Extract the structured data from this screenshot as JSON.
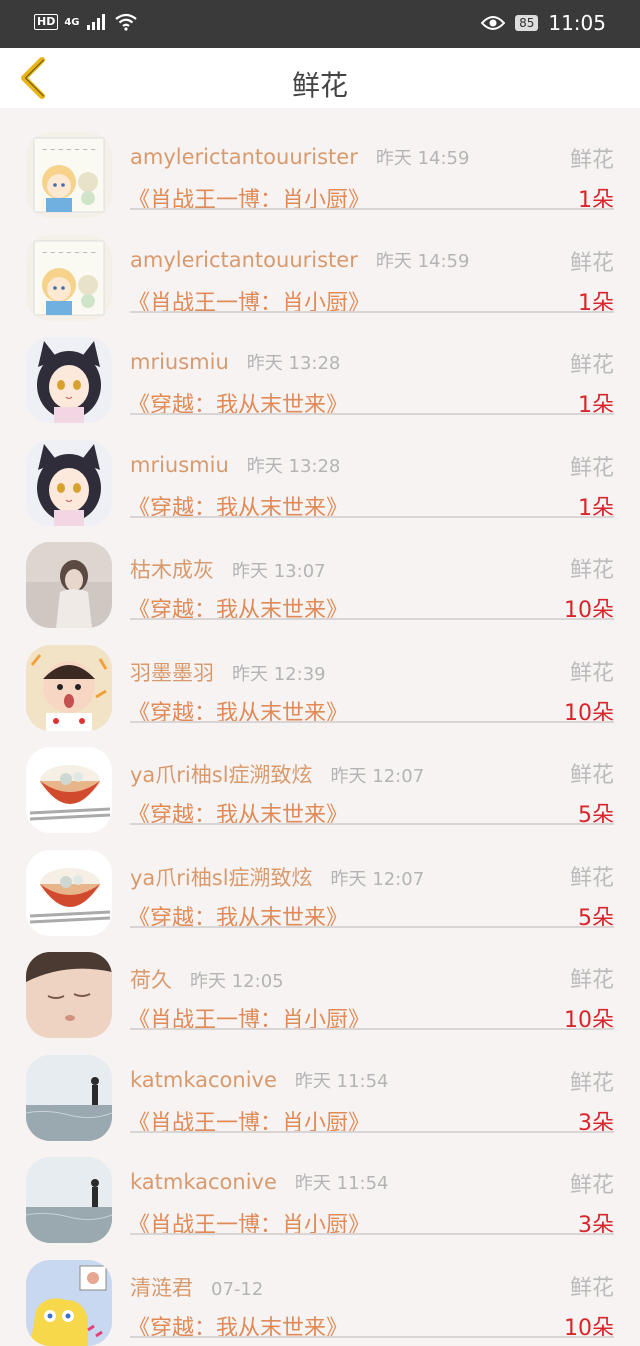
{
  "status_bar": {
    "hd": "HD",
    "signal": "4G",
    "battery": "85",
    "time": "11:05"
  },
  "header": {
    "title": "鲜花"
  },
  "rows": [
    {
      "name": "amylerictantouurister",
      "time": "昨天 14:59",
      "type": "鲜花",
      "book": "《肖战王一博：肖小厨》",
      "count": "1朵",
      "avatar": "comic"
    },
    {
      "name": "amylerictantouurister",
      "time": "昨天 14:59",
      "type": "鲜花",
      "book": "《肖战王一博：肖小厨》",
      "count": "1朵",
      "avatar": "comic"
    },
    {
      "name": "mriusmiu",
      "time": "昨天 13:28",
      "type": "鲜花",
      "book": "《穿越：我从末世来》",
      "count": "1朵",
      "avatar": "catgirl"
    },
    {
      "name": "mriusmiu",
      "time": "昨天 13:28",
      "type": "鲜花",
      "book": "《穿越：我从末世来》",
      "count": "1朵",
      "avatar": "catgirl"
    },
    {
      "name": "枯木成灰",
      "time": "昨天 13:07",
      "type": "鲜花",
      "book": "《穿越：我从末世来》",
      "count": "10朵",
      "avatar": "girl"
    },
    {
      "name": "羽墨墨羽",
      "time": "昨天 12:39",
      "type": "鲜花",
      "book": "《穿越：我从末世来》",
      "count": "10朵",
      "avatar": "baby"
    },
    {
      "name": "ya爪ri柚sl症溯致炫",
      "time": "昨天 12:07",
      "type": "鲜花",
      "book": "《穿越：我从末世来》",
      "count": "5朵",
      "avatar": "bowl"
    },
    {
      "name": "ya爪ri柚sl症溯致炫",
      "time": "昨天 12:07",
      "type": "鲜花",
      "book": "《穿越：我从末世来》",
      "count": "5朵",
      "avatar": "bowl"
    },
    {
      "name": "荷久",
      "time": "昨天 12:05",
      "type": "鲜花",
      "book": "《肖战王一博：肖小厨》",
      "count": "10朵",
      "avatar": "sleeping"
    },
    {
      "name": "katmkaconive",
      "time": "昨天 11:54",
      "type": "鲜花",
      "book": "《肖战王一博：肖小厨》",
      "count": "3朵",
      "avatar": "sea"
    },
    {
      "name": "katmkaconive",
      "time": "昨天 11:54",
      "type": "鲜花",
      "book": "《肖战王一博：肖小厨》",
      "count": "3朵",
      "avatar": "sea"
    },
    {
      "name": "清涟君",
      "time": "07-12",
      "type": "鲜花",
      "book": "《穿越：我从末世来》",
      "count": "10朵",
      "avatar": "sponge"
    }
  ]
}
